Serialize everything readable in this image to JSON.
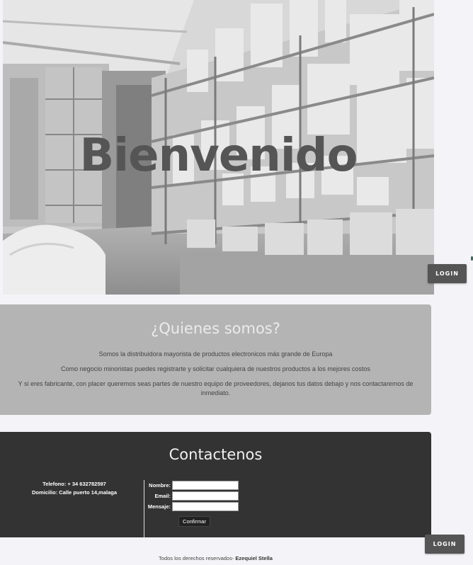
{
  "hero": {
    "title": "Bienvenido",
    "image": "warehouse-shelves-grayscale"
  },
  "login": {
    "label_1": "LOGIN",
    "label_2": "LOGIN"
  },
  "about": {
    "title": "¿Quienes somos?",
    "paragraph_1": "Somos la distribuidora mayorista de productos electronicos más grande de Europa",
    "paragraph_2": "Como negocio minoristas puedes registrarte y solicitar cualquiera de nuestros productos a los mejores costos",
    "paragraph_3": "Y si eres fabricante, con placer queremos seas partes de nuestro equipo de proveedores, dejanos tus datos debajo y nos contactaremos de inmediato."
  },
  "contact": {
    "title": "Contactenos",
    "phone": "Telefono: + 34 632782597",
    "address": "Domicilio: Calle puerto 14,malaga",
    "form": {
      "name_label": "Nombre:",
      "email_label": "Email:",
      "message_label": "Mensaje:",
      "name_value": "",
      "email_value": "",
      "message_value": "",
      "confirm_label": "Confirmar"
    }
  },
  "footer": {
    "text": "Todos los derechos reservados- ",
    "author": "Ezequiel Stella"
  },
  "colors": {
    "page_bg": "#f4f4f8",
    "about_bg": "#b4b4b4",
    "contact_bg": "#333333",
    "button_bg": "#555555"
  }
}
